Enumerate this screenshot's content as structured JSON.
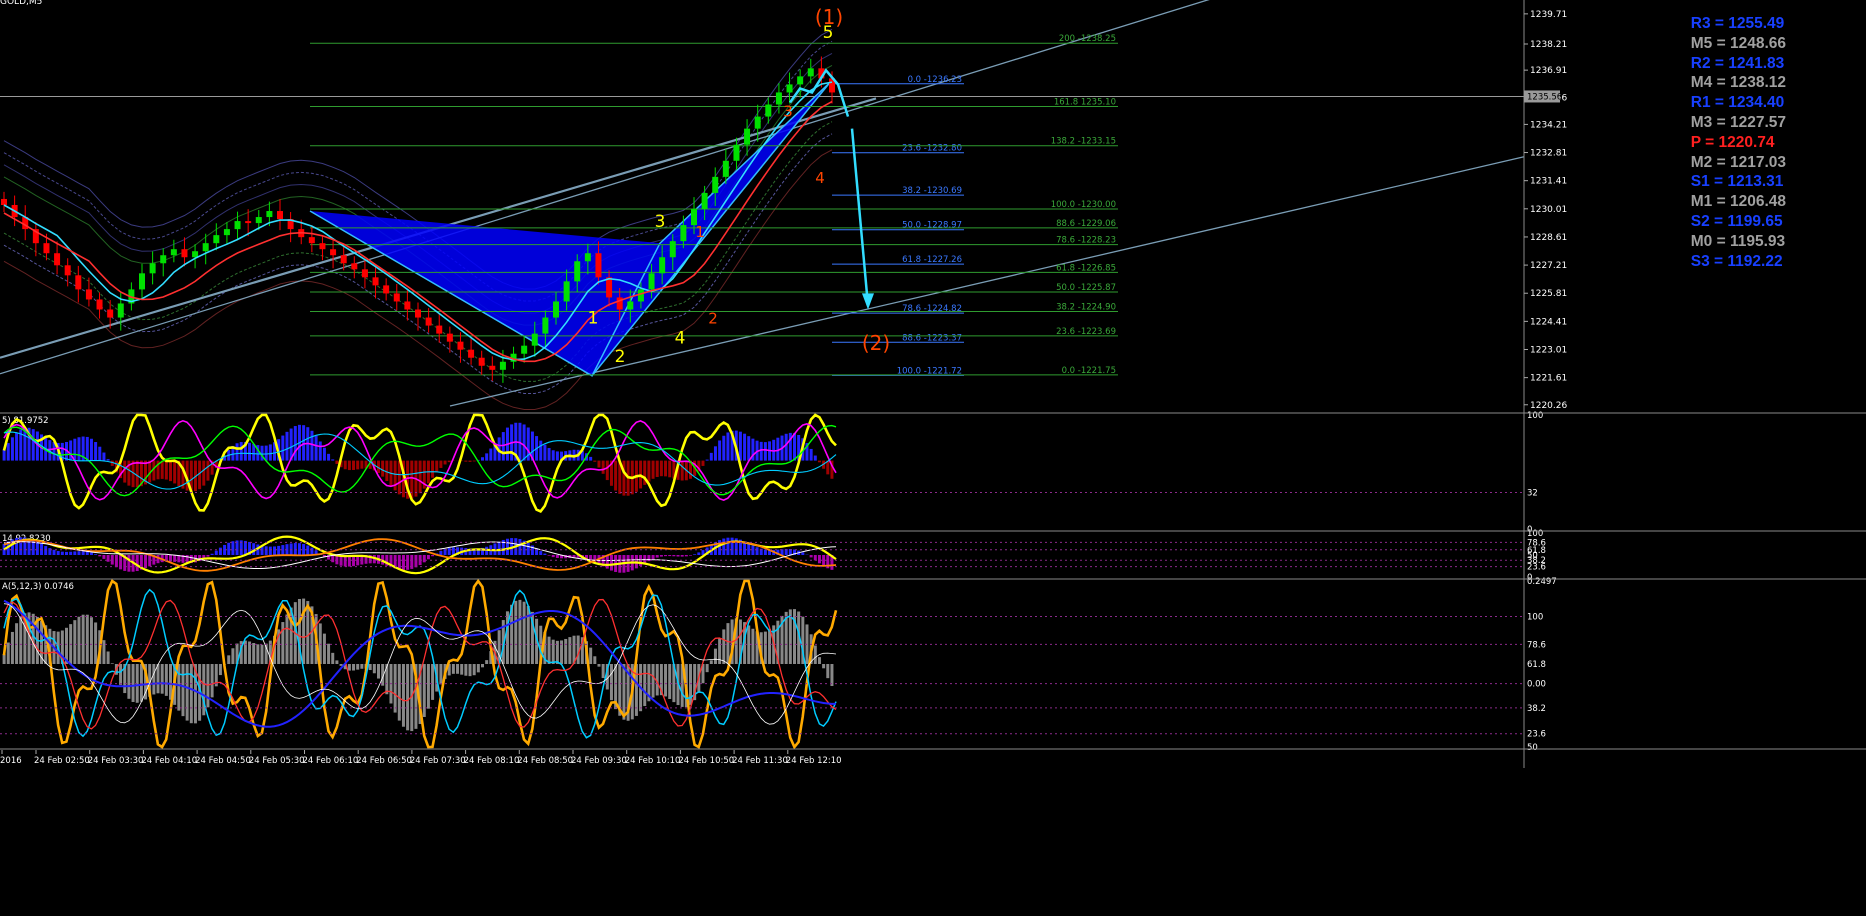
{
  "symbol_label": "GOLD,M5",
  "colors": {
    "background": "#000000",
    "grid": "#2a2a2a",
    "bull": "#00e000",
    "bear": "#ff0000",
    "harmonic_fill": "#0000ff",
    "harmonic_edge": "#33bbff",
    "trend_line": "#7a9db5",
    "fib_blue": "#3a78ff",
    "fib_green": "#2f9b2f",
    "yellow_label": "#ffff00",
    "orange_label": "#ff4500",
    "arrow": "#33ddff",
    "axis_text": "#ffffff"
  },
  "pivots": [
    {
      "label": "R3 = 1255.49",
      "color": "#1840ff"
    },
    {
      "label": "M5 = 1248.66",
      "color": "#a0a0a0"
    },
    {
      "label": "R2 = 1241.83",
      "color": "#1840ff"
    },
    {
      "label": "M4 = 1238.12",
      "color": "#a0a0a0"
    },
    {
      "label": "R1 = 1234.40",
      "color": "#1840ff"
    },
    {
      "label": "M3 = 1227.57",
      "color": "#a0a0a0"
    },
    {
      "label": "P   = 1220.74",
      "color": "#ff2020"
    },
    {
      "label": "M2 = 1217.03",
      "color": "#a0a0a0"
    },
    {
      "label": "S1 = 1213.31",
      "color": "#1840ff"
    },
    {
      "label": "M1 = 1206.48",
      "color": "#a0a0a0"
    },
    {
      "label": "S2 = 1199.65",
      "color": "#1840ff"
    },
    {
      "label": "M0 = 1195.93",
      "color": "#a0a0a0"
    },
    {
      "label": "S3 = 1192.22",
      "color": "#1840ff"
    }
  ],
  "chart_data": [
    {
      "type": "line",
      "title": "GOLD,M5",
      "subtype": "candlestick",
      "y_ticks": [
        "1239.71",
        "1238.21",
        "1236.91",
        "1235.56",
        "1234.21",
        "1232.81",
        "1231.41",
        "1230.01",
        "1228.61",
        "1227.21",
        "1225.81",
        "1224.41",
        "1223.01",
        "1221.61",
        "1220.26"
      ],
      "y_tick_values": [
        1239.71,
        1238.21,
        1236.91,
        1235.56,
        1234.21,
        1232.81,
        1231.41,
        1230.01,
        1228.61,
        1227.21,
        1225.81,
        1224.41,
        1223.01,
        1221.61,
        1220.26
      ],
      "ylim": [
        1219.9,
        1240.4
      ],
      "current_price_label": "1235.56",
      "x_ticks": [
        "2016",
        "24 Feb 02:50",
        "24 Feb 03:30",
        "24 Feb 04:10",
        "24 Feb 04:50",
        "24 Feb 05:30",
        "24 Feb 06:10",
        "24 Feb 06:50",
        "24 Feb 07:30",
        "24 Feb 08:10",
        "24 Feb 08:50",
        "24 Feb 09:30",
        "24 Feb 10:10",
        "24 Feb 10:50",
        "24 Feb 11:30",
        "24 Feb 12:10"
      ],
      "closes_approx": [
        1230.2,
        1229.6,
        1229.0,
        1228.3,
        1227.8,
        1227.2,
        1226.7,
        1226.0,
        1225.5,
        1225.0,
        1224.6,
        1225.3,
        1226.0,
        1226.8,
        1227.3,
        1227.7,
        1228.0,
        1227.6,
        1227.9,
        1228.3,
        1228.7,
        1229.0,
        1229.4,
        1229.3,
        1229.6,
        1229.9,
        1229.5,
        1229.0,
        1228.6,
        1228.3,
        1228.0,
        1227.7,
        1227.3,
        1227.0,
        1226.6,
        1226.2,
        1225.8,
        1225.4,
        1225.0,
        1224.6,
        1224.2,
        1223.8,
        1223.4,
        1223.0,
        1222.6,
        1222.2,
        1222.0,
        1222.4,
        1222.8,
        1223.2,
        1223.8,
        1224.6,
        1225.4,
        1226.4,
        1227.4,
        1227.8,
        1226.6,
        1225.6,
        1225.0,
        1225.4,
        1226.0,
        1226.8,
        1227.6,
        1228.4,
        1229.2,
        1230.0,
        1230.8,
        1231.6,
        1232.4,
        1233.2,
        1234.0,
        1234.6,
        1235.2,
        1235.8,
        1236.2,
        1236.6,
        1237.0,
        1236.5,
        1235.8
      ],
      "fibonacci_left": [
        {
          "label": "0.0 -1236.23",
          "value": 1236.23
        },
        {
          "label": "23.6 -1232.80",
          "value": 1232.8
        },
        {
          "label": "38.2 -1230.69",
          "value": 1230.69
        },
        {
          "label": "50.0 -1228.97",
          "value": 1228.97
        },
        {
          "label": "61.8 -1227.26",
          "value": 1227.26
        },
        {
          "label": "78.6 -1224.82",
          "value": 1224.82
        },
        {
          "label": "88.6 -1223.37",
          "value": 1223.37
        },
        {
          "label": "100.0 -1221.72",
          "value": 1221.72
        }
      ],
      "fibonacci_right": [
        {
          "label": "200 -1238.25",
          "value": 1238.25
        },
        {
          "label": "161.8 1235.10",
          "value": 1235.1
        },
        {
          "label": "138.2 -1233.15",
          "value": 1233.15
        },
        {
          "label": "100.0 -1230.00",
          "value": 1230.0
        },
        {
          "label": "88.6 -1229.06",
          "value": 1229.06
        },
        {
          "label": "78.6 -1228.23",
          "value": 1228.23
        },
        {
          "label": "61.8 -1226.85",
          "value": 1226.85
        },
        {
          "label": "50.0 -1225.87",
          "value": 1225.87
        },
        {
          "label": "38.2 -1224.90",
          "value": 1224.9
        },
        {
          "label": "23.6 -1223.69",
          "value": 1223.69
        },
        {
          "label": "0.0 -1221.75",
          "value": 1221.75
        }
      ],
      "wave_labels_yellow": [
        "1",
        "2",
        "3",
        "4",
        "5"
      ],
      "wave_labels_orange_inner": [
        "1",
        "2",
        "3",
        "4"
      ],
      "wave_labels_degree": [
        "(1)",
        "(2)"
      ]
    },
    {
      "type": "line",
      "title": "5) 81.9752",
      "y_ticks": [
        "100",
        "32",
        "0"
      ],
      "y_tick_values": [
        100,
        32,
        0
      ],
      "ylim": [
        0,
        100
      ]
    },
    {
      "type": "line",
      "title": "14 92.8230",
      "y_ticks": [
        "100",
        "78.6",
        "61.8",
        "50",
        "38.2",
        "23.6",
        "0"
      ],
      "y_tick_values": [
        100,
        78.6,
        61.8,
        50,
        38.2,
        23.6,
        0
      ],
      "ylim": [
        0,
        100
      ]
    },
    {
      "type": "line",
      "title": "A(5,12,3) 0.0746",
      "y_ticks": [
        "0.2497",
        "100",
        "78.6",
        "61.8",
        "50",
        "0.00",
        "38.2",
        "23.6",
        "8",
        "0.307"
      ],
      "y_tick_values": [
        100,
        78.6,
        61.8,
        50,
        0,
        38.2,
        23.6,
        8
      ],
      "ylim": [
        0,
        100
      ]
    }
  ]
}
